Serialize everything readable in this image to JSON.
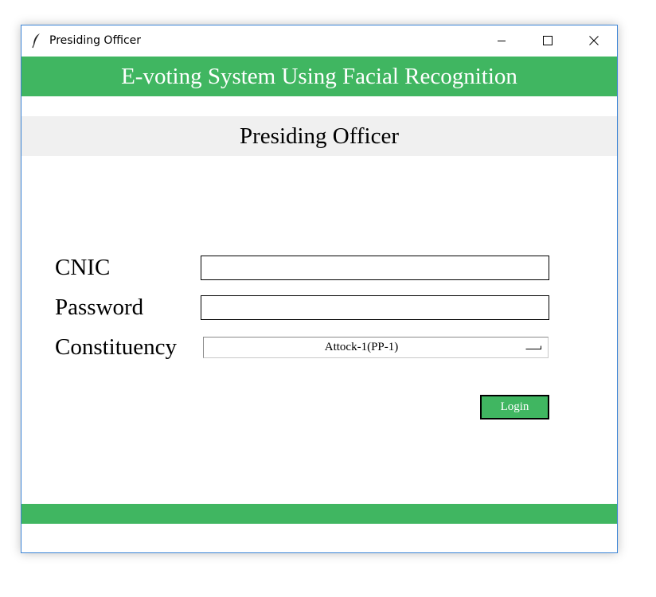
{
  "window": {
    "title": "Presiding Officer",
    "icon": "feather-icon"
  },
  "header": {
    "title": "E-voting System Using Facial Recognition"
  },
  "subheader": {
    "title": "Presiding Officer"
  },
  "form": {
    "cnic_label": "CNIC",
    "cnic_value": "",
    "password_label": "Password",
    "password_value": "",
    "constituency_label": "Constituency",
    "constituency_selected": "Attock-1(PP-1)",
    "login_label": "Login"
  },
  "colors": {
    "accent": "#40b661",
    "subheader_bg": "#f0f0f0",
    "window_border": "#3b84d6"
  }
}
